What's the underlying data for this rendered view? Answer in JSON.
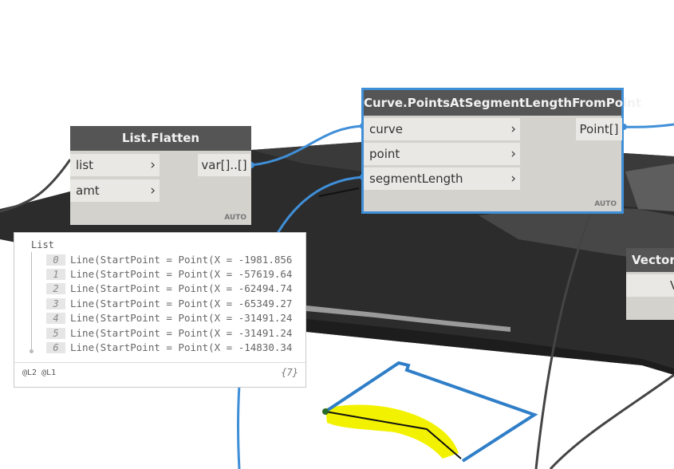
{
  "nodes": {
    "list_flatten": {
      "title": "List.Flatten",
      "inputs": [
        "list",
        "amt"
      ],
      "output": "var[]..[]",
      "lacing": "AUTO"
    },
    "points_at_segment": {
      "title": "Curve.PointsAtSegmentLengthFromPoint",
      "inputs": [
        "curve",
        "point",
        "segmentLength"
      ],
      "output": "Point[]",
      "lacing": "AUTO"
    },
    "vector_partial": {
      "title": "Vector.",
      "input_partial": "V"
    }
  },
  "preview": {
    "title": "List",
    "rows": [
      {
        "index": "0",
        "text": "Line(StartPoint = Point(X = -1981.856"
      },
      {
        "index": "1",
        "text": "Line(StartPoint = Point(X = -57619.64"
      },
      {
        "index": "2",
        "text": "Line(StartPoint = Point(X = -62494.74"
      },
      {
        "index": "3",
        "text": "Line(StartPoint = Point(X = -65349.27"
      },
      {
        "index": "4",
        "text": "Line(StartPoint = Point(X = -31491.24"
      },
      {
        "index": "5",
        "text": "Line(StartPoint = Point(X = -31491.24"
      },
      {
        "index": "6",
        "text": "Line(StartPoint = Point(X = -14830.34"
      }
    ],
    "levels": "@L2 @L1",
    "count": "{7}"
  },
  "colors": {
    "wire": "#3f8fd8",
    "node_header": "#555555",
    "node_body": "#d4d2cd",
    "highlight": "#f2f200",
    "terrain": "#2f2f2f"
  }
}
